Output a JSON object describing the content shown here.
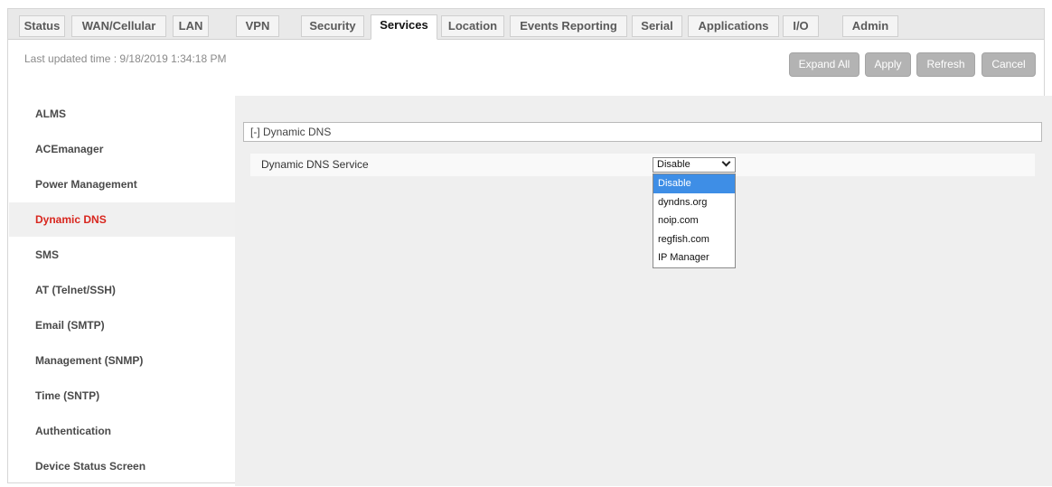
{
  "tabs": [
    {
      "label": "Status",
      "active": false
    },
    {
      "label": "WAN/Cellular",
      "active": false
    },
    {
      "label": "LAN",
      "active": false
    },
    {
      "label": "VPN",
      "active": false
    },
    {
      "label": "Security",
      "active": false
    },
    {
      "label": "Services",
      "active": true
    },
    {
      "label": "Location",
      "active": false
    },
    {
      "label": "Events Reporting",
      "active": false
    },
    {
      "label": "Serial",
      "active": false
    },
    {
      "label": "Applications",
      "active": false
    },
    {
      "label": "I/O",
      "active": false
    },
    {
      "label": "Admin",
      "active": false
    }
  ],
  "toolbar": {
    "last_updated": "Last updated time : 9/18/2019 1:34:18 PM",
    "expand_all": "Expand All",
    "apply": "Apply",
    "refresh": "Refresh",
    "cancel": "Cancel"
  },
  "sidebar": {
    "items": [
      {
        "label": "ALMS"
      },
      {
        "label": "ACEmanager"
      },
      {
        "label": "Power Management"
      },
      {
        "label": "Dynamic DNS",
        "active": true
      },
      {
        "label": "SMS"
      },
      {
        "label": "AT (Telnet/SSH)"
      },
      {
        "label": "Email (SMTP)"
      },
      {
        "label": "Management (SNMP)"
      },
      {
        "label": "Time (SNTP)"
      },
      {
        "label": "Authentication"
      },
      {
        "label": "Device Status Screen"
      }
    ]
  },
  "main": {
    "section_title": "[-] Dynamic DNS",
    "field_label": "Dynamic DNS Service",
    "select_value": "Disable",
    "options": [
      "Disable",
      "dyndns.org",
      "noip.com",
      "regfish.com",
      "IP Manager"
    ],
    "highlighted_option": "Disable"
  },
  "colors": {
    "active_sidebar_text": "#d8261e",
    "highlight": "#3e8ee6",
    "button_bg": "#b3b3b3",
    "content_bg": "#efefef"
  }
}
